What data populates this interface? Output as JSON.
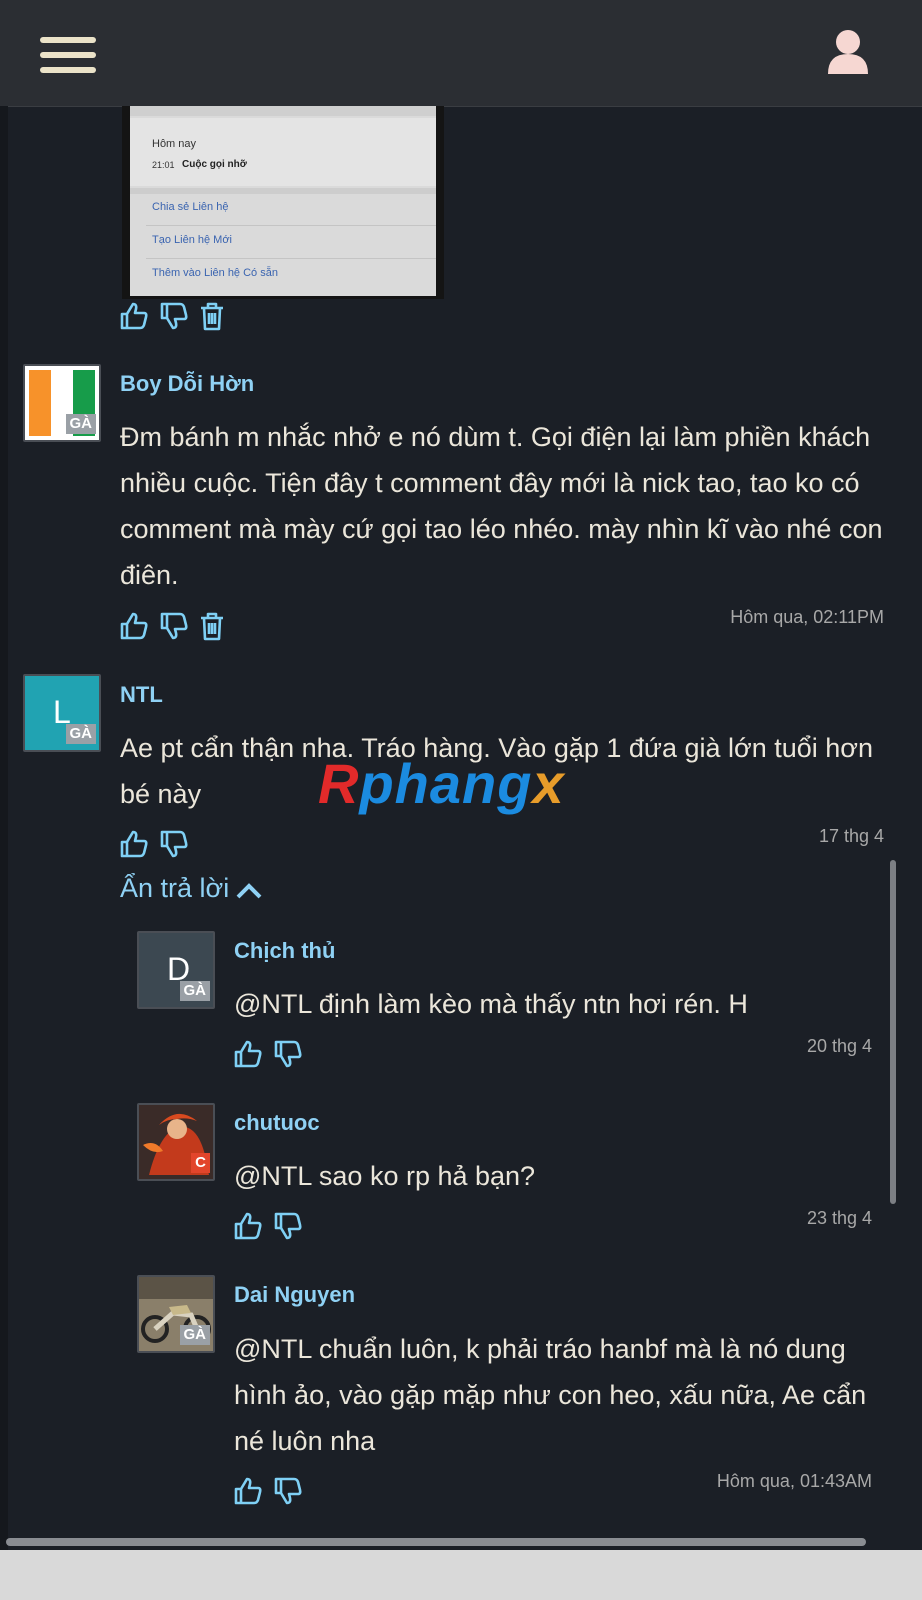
{
  "header": {
    "menu_icon": "hamburger-icon",
    "user_icon": "user-icon",
    "background": "#2b2e33"
  },
  "attachment": {
    "date_label": "Hôm nay",
    "time": "21:01",
    "call_label": "Cuộc gọi nhỡ",
    "links": [
      "Chia sẻ Liên hệ",
      "Tạo Liên hệ Mới",
      "Thêm vào Liên hệ Có sẵn"
    ]
  },
  "comments": [
    {
      "username": "Boy Dỗi Hờn",
      "badge": "GÀ",
      "body": "Đm bánh m nhắc nhở e nó dùm t. Gọi điện lại làm phiền khách nhiều cuộc. Tiện đây t comment đây mới là nick tao, tao ko có comment mà mày cứ gọi tao léo nhéo. mày nhìn kĩ vào nhé con điên.",
      "time": "Hôm qua, 02:11PM"
    },
    {
      "username": "NTL",
      "avatar_letter": "L",
      "badge": "GÀ",
      "body": "Ae pt cẩn thận nha. Tráo hàng. Vào gặp 1 đứa già lớn tuổi hơn bé này",
      "time": "17 thg 4"
    }
  ],
  "toggle_replies": "Ẩn trả lời",
  "replies": [
    {
      "username": "Chịch thủ",
      "avatar_letter": "D",
      "badge": "GÀ",
      "body": "@NTL định làm kèo mà thấy ntn hơi rén. H",
      "time": "20 thg 4"
    },
    {
      "username": "chutuoc",
      "badge": "C",
      "body": "@NTL sao ko rp hả bạn?",
      "time": "23 thg 4"
    },
    {
      "username": "Dai Nguyen",
      "badge": "GÀ",
      "body": "@NTL chuẩn luôn, k phải tráo hanbf mà là nó dung hình ảo, vào gặp mặp như con heo, xấu nữa, Ae cẩn né luôn nha",
      "time": "Hôm qua, 01:43AM"
    }
  ],
  "watermark": {
    "part1": "R",
    "part2": "phang",
    "part3": "x"
  },
  "colors": {
    "background": "#1b1f26",
    "username": "#8fd1f4",
    "icon": "#7fd0f5",
    "text": "#ebe6da",
    "time": "#a8a8a8"
  }
}
